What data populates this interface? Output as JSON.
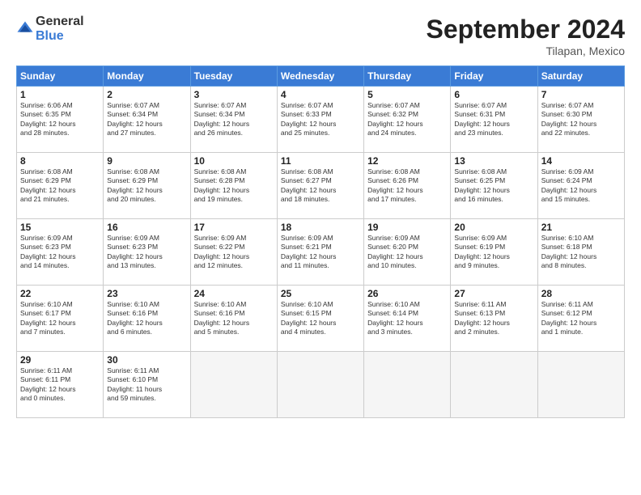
{
  "header": {
    "logo_general": "General",
    "logo_blue": "Blue",
    "month_title": "September 2024",
    "location": "Tilapan, Mexico"
  },
  "weekdays": [
    "Sunday",
    "Monday",
    "Tuesday",
    "Wednesday",
    "Thursday",
    "Friday",
    "Saturday"
  ],
  "weeks": [
    [
      {
        "day": "1",
        "lines": [
          "Sunrise: 6:06 AM",
          "Sunset: 6:35 PM",
          "Daylight: 12 hours",
          "and 28 minutes."
        ]
      },
      {
        "day": "2",
        "lines": [
          "Sunrise: 6:07 AM",
          "Sunset: 6:34 PM",
          "Daylight: 12 hours",
          "and 27 minutes."
        ]
      },
      {
        "day": "3",
        "lines": [
          "Sunrise: 6:07 AM",
          "Sunset: 6:34 PM",
          "Daylight: 12 hours",
          "and 26 minutes."
        ]
      },
      {
        "day": "4",
        "lines": [
          "Sunrise: 6:07 AM",
          "Sunset: 6:33 PM",
          "Daylight: 12 hours",
          "and 25 minutes."
        ]
      },
      {
        "day": "5",
        "lines": [
          "Sunrise: 6:07 AM",
          "Sunset: 6:32 PM",
          "Daylight: 12 hours",
          "and 24 minutes."
        ]
      },
      {
        "day": "6",
        "lines": [
          "Sunrise: 6:07 AM",
          "Sunset: 6:31 PM",
          "Daylight: 12 hours",
          "and 23 minutes."
        ]
      },
      {
        "day": "7",
        "lines": [
          "Sunrise: 6:07 AM",
          "Sunset: 6:30 PM",
          "Daylight: 12 hours",
          "and 22 minutes."
        ]
      }
    ],
    [
      {
        "day": "8",
        "lines": [
          "Sunrise: 6:08 AM",
          "Sunset: 6:29 PM",
          "Daylight: 12 hours",
          "and 21 minutes."
        ]
      },
      {
        "day": "9",
        "lines": [
          "Sunrise: 6:08 AM",
          "Sunset: 6:29 PM",
          "Daylight: 12 hours",
          "and 20 minutes."
        ]
      },
      {
        "day": "10",
        "lines": [
          "Sunrise: 6:08 AM",
          "Sunset: 6:28 PM",
          "Daylight: 12 hours",
          "and 19 minutes."
        ]
      },
      {
        "day": "11",
        "lines": [
          "Sunrise: 6:08 AM",
          "Sunset: 6:27 PM",
          "Daylight: 12 hours",
          "and 18 minutes."
        ]
      },
      {
        "day": "12",
        "lines": [
          "Sunrise: 6:08 AM",
          "Sunset: 6:26 PM",
          "Daylight: 12 hours",
          "and 17 minutes."
        ]
      },
      {
        "day": "13",
        "lines": [
          "Sunrise: 6:08 AM",
          "Sunset: 6:25 PM",
          "Daylight: 12 hours",
          "and 16 minutes."
        ]
      },
      {
        "day": "14",
        "lines": [
          "Sunrise: 6:09 AM",
          "Sunset: 6:24 PM",
          "Daylight: 12 hours",
          "and 15 minutes."
        ]
      }
    ],
    [
      {
        "day": "15",
        "lines": [
          "Sunrise: 6:09 AM",
          "Sunset: 6:23 PM",
          "Daylight: 12 hours",
          "and 14 minutes."
        ]
      },
      {
        "day": "16",
        "lines": [
          "Sunrise: 6:09 AM",
          "Sunset: 6:23 PM",
          "Daylight: 12 hours",
          "and 13 minutes."
        ]
      },
      {
        "day": "17",
        "lines": [
          "Sunrise: 6:09 AM",
          "Sunset: 6:22 PM",
          "Daylight: 12 hours",
          "and 12 minutes."
        ]
      },
      {
        "day": "18",
        "lines": [
          "Sunrise: 6:09 AM",
          "Sunset: 6:21 PM",
          "Daylight: 12 hours",
          "and 11 minutes."
        ]
      },
      {
        "day": "19",
        "lines": [
          "Sunrise: 6:09 AM",
          "Sunset: 6:20 PM",
          "Daylight: 12 hours",
          "and 10 minutes."
        ]
      },
      {
        "day": "20",
        "lines": [
          "Sunrise: 6:09 AM",
          "Sunset: 6:19 PM",
          "Daylight: 12 hours",
          "and 9 minutes."
        ]
      },
      {
        "day": "21",
        "lines": [
          "Sunrise: 6:10 AM",
          "Sunset: 6:18 PM",
          "Daylight: 12 hours",
          "and 8 minutes."
        ]
      }
    ],
    [
      {
        "day": "22",
        "lines": [
          "Sunrise: 6:10 AM",
          "Sunset: 6:17 PM",
          "Daylight: 12 hours",
          "and 7 minutes."
        ]
      },
      {
        "day": "23",
        "lines": [
          "Sunrise: 6:10 AM",
          "Sunset: 6:16 PM",
          "Daylight: 12 hours",
          "and 6 minutes."
        ]
      },
      {
        "day": "24",
        "lines": [
          "Sunrise: 6:10 AM",
          "Sunset: 6:16 PM",
          "Daylight: 12 hours",
          "and 5 minutes."
        ]
      },
      {
        "day": "25",
        "lines": [
          "Sunrise: 6:10 AM",
          "Sunset: 6:15 PM",
          "Daylight: 12 hours",
          "and 4 minutes."
        ]
      },
      {
        "day": "26",
        "lines": [
          "Sunrise: 6:10 AM",
          "Sunset: 6:14 PM",
          "Daylight: 12 hours",
          "and 3 minutes."
        ]
      },
      {
        "day": "27",
        "lines": [
          "Sunrise: 6:11 AM",
          "Sunset: 6:13 PM",
          "Daylight: 12 hours",
          "and 2 minutes."
        ]
      },
      {
        "day": "28",
        "lines": [
          "Sunrise: 6:11 AM",
          "Sunset: 6:12 PM",
          "Daylight: 12 hours",
          "and 1 minute."
        ]
      }
    ],
    [
      {
        "day": "29",
        "lines": [
          "Sunrise: 6:11 AM",
          "Sunset: 6:11 PM",
          "Daylight: 12 hours",
          "and 0 minutes."
        ]
      },
      {
        "day": "30",
        "lines": [
          "Sunrise: 6:11 AM",
          "Sunset: 6:10 PM",
          "Daylight: 11 hours",
          "and 59 minutes."
        ]
      },
      null,
      null,
      null,
      null,
      null
    ]
  ]
}
